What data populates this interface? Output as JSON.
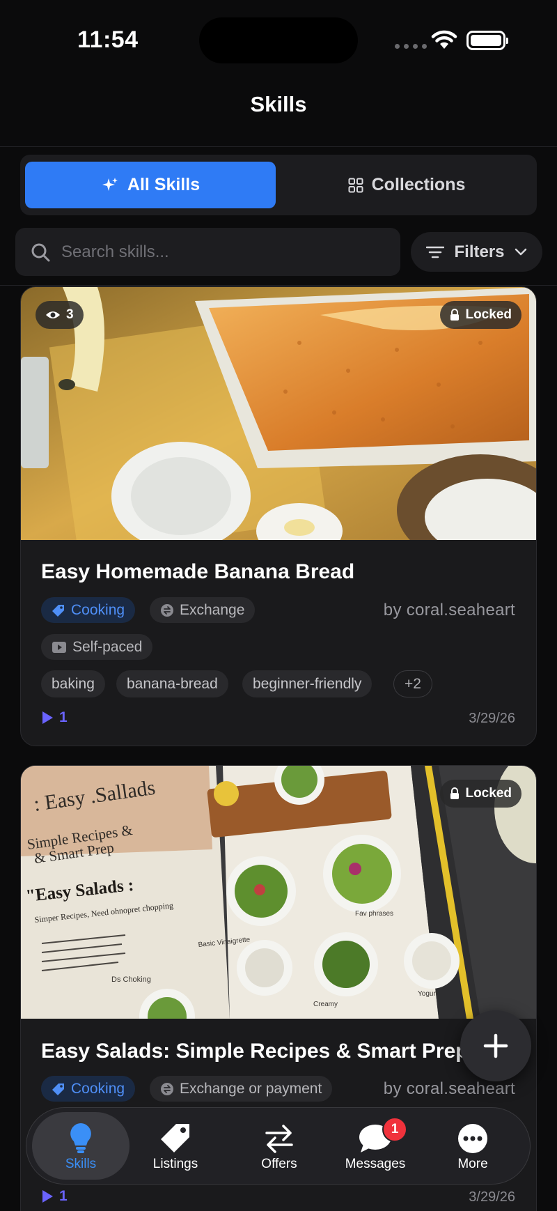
{
  "status_bar": {
    "time": "11:54"
  },
  "header": {
    "title": "Skills"
  },
  "segments": {
    "all_skills": "All Skills",
    "collections": "Collections"
  },
  "search": {
    "placeholder": "Search skills...",
    "filters_label": "Filters"
  },
  "cards": [
    {
      "views": "3",
      "locked_label": "Locked",
      "title": "Easy Homemade Banana Bread",
      "category": "Cooking",
      "exchange": "Exchange",
      "author": "by coral.seaheart",
      "format": "Self-paced",
      "tags": [
        "baking",
        "banana-bread",
        "beginner-friendly"
      ],
      "more_tags": "+2",
      "plays": "1",
      "date": "3/29/26"
    },
    {
      "locked_label": "Locked",
      "title": "Easy Salads: Simple Recipes & Smart Prep",
      "category": "Cooking",
      "exchange": "Exchange or payment",
      "author": "by coral.seaheart",
      "plays": "1",
      "date": "3/29/26",
      "image_text": {
        "heading": ": Easy .Sallads",
        "subheading_1": "Simple Recipes &",
        "subheading_2": "& Smart Prep",
        "page_title": "\"Easy Salads :",
        "page_sub": "Simper Recipes, Need ohnopret chopping",
        "label_vinaigrette": "Basic Vinaigrette",
        "label_fav": "Fav phrases",
        "label_yogurt": "Yogurt",
        "label_creamy": "Creamy",
        "label_dressing": "Ds Choking"
      }
    }
  ],
  "tabbar": {
    "items": [
      {
        "label": "Skills",
        "icon": "lightbulb-icon"
      },
      {
        "label": "Listings",
        "icon": "tag-icon"
      },
      {
        "label": "Offers",
        "icon": "swap-arrows-icon"
      },
      {
        "label": "Messages",
        "icon": "chat-bubble-icon"
      },
      {
        "label": "More",
        "icon": "more-dots-icon"
      }
    ],
    "messages_badge": "1"
  },
  "colors": {
    "accent": "#2f7bf5",
    "tab_active": "#3a8ff7",
    "play": "#6a63ff",
    "badge": "#f0323c"
  }
}
